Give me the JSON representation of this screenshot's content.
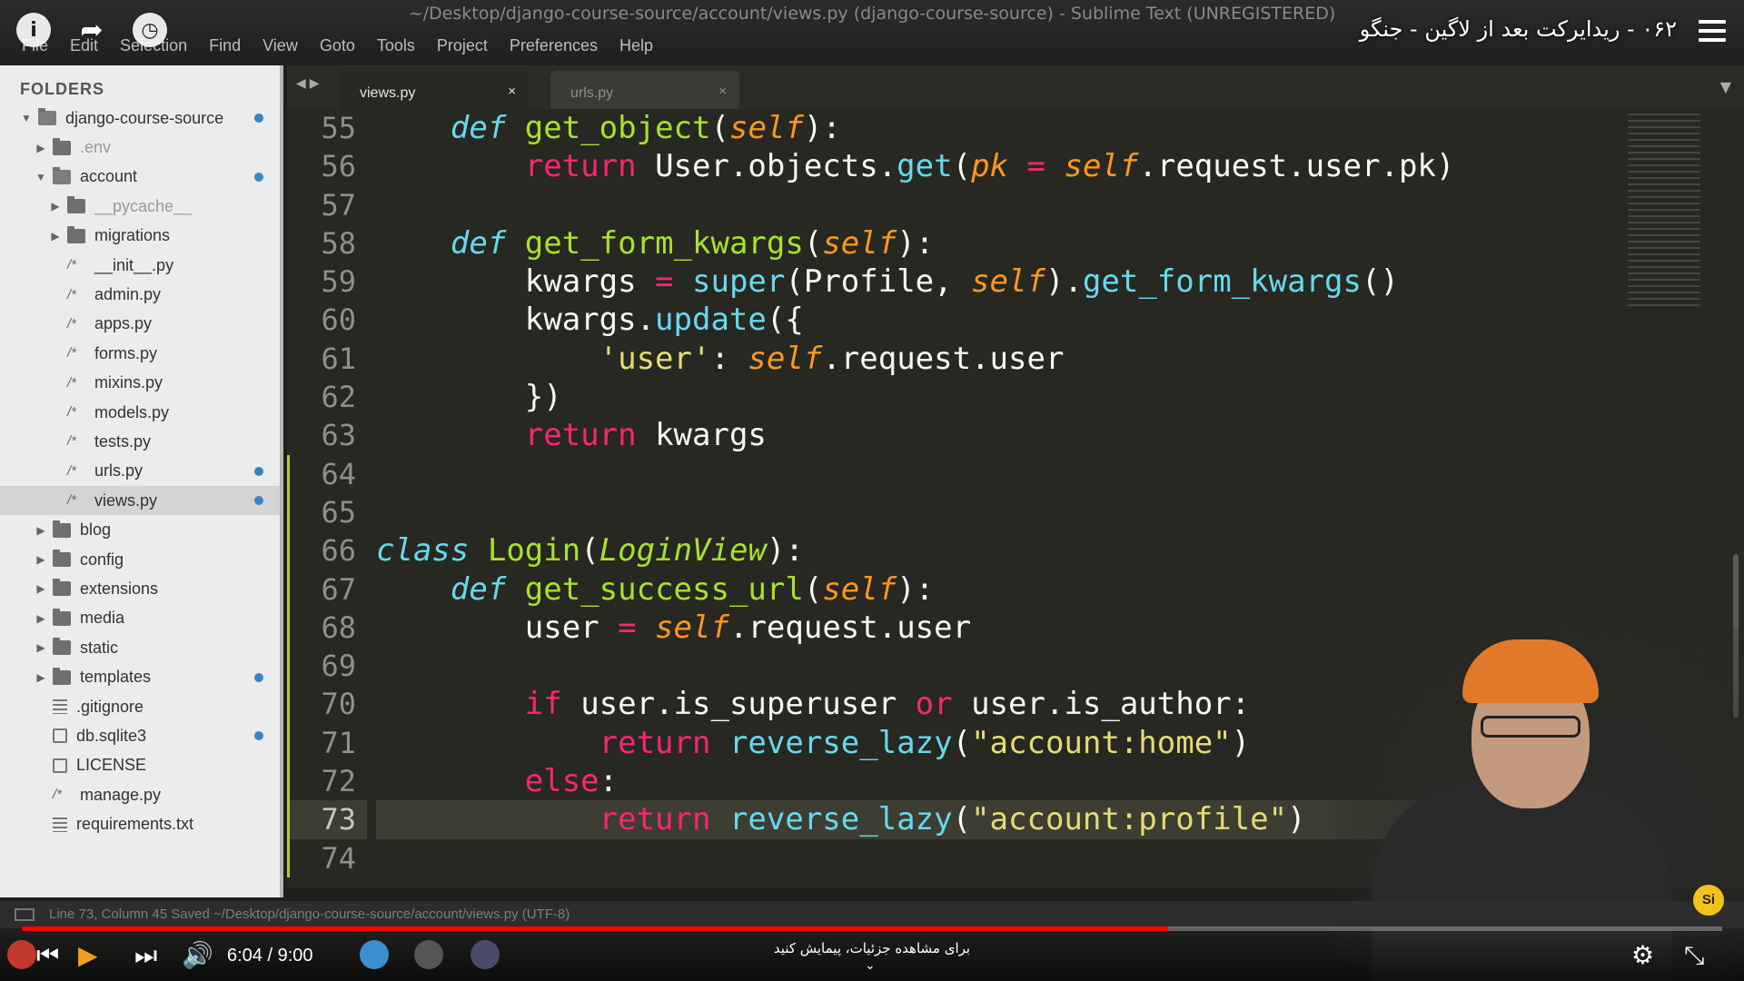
{
  "window": {
    "title": "~/Desktop/django-course-source/account/views.py (django-course-source) - Sublime Text (UNREGISTERED)"
  },
  "menu": [
    "File",
    "Edit",
    "Selection",
    "Find",
    "View",
    "Goto",
    "Tools",
    "Project",
    "Preferences",
    "Help"
  ],
  "youtube": {
    "video_title": "۰۶۲ - ریدایرکت بعد از لاگین - جنگو",
    "time": "6:04 / 9:00",
    "progress_fraction": 0.674,
    "caption_hint": "برای مشاهده جزئیات، پیمایش کنید",
    "badge": "Si"
  },
  "sidebar": {
    "header": "FOLDERS",
    "items": [
      {
        "label": "django-course-source",
        "depth": 0,
        "kind": "folder-open",
        "arrow": "down",
        "dot": true
      },
      {
        "label": ".env",
        "depth": 1,
        "kind": "folder",
        "arrow": "right",
        "dim": true
      },
      {
        "label": "account",
        "depth": 1,
        "kind": "folder-open",
        "arrow": "down",
        "dot": true
      },
      {
        "label": "__pycache__",
        "depth": 2,
        "kind": "folder",
        "arrow": "right",
        "dim": true
      },
      {
        "label": "migrations",
        "depth": 2,
        "kind": "folder",
        "arrow": "right"
      },
      {
        "label": "__init__.py",
        "depth": 2,
        "kind": "file"
      },
      {
        "label": "admin.py",
        "depth": 2,
        "kind": "file"
      },
      {
        "label": "apps.py",
        "depth": 2,
        "kind": "file"
      },
      {
        "label": "forms.py",
        "depth": 2,
        "kind": "file"
      },
      {
        "label": "mixins.py",
        "depth": 2,
        "kind": "file"
      },
      {
        "label": "models.py",
        "depth": 2,
        "kind": "file"
      },
      {
        "label": "tests.py",
        "depth": 2,
        "kind": "file"
      },
      {
        "label": "urls.py",
        "depth": 2,
        "kind": "file",
        "dot": true
      },
      {
        "label": "views.py",
        "depth": 2,
        "kind": "file",
        "dot": true,
        "selected": true
      },
      {
        "label": "blog",
        "depth": 1,
        "kind": "folder",
        "arrow": "right"
      },
      {
        "label": "config",
        "depth": 1,
        "kind": "folder",
        "arrow": "right"
      },
      {
        "label": "extensions",
        "depth": 1,
        "kind": "folder",
        "arrow": "right"
      },
      {
        "label": "media",
        "depth": 1,
        "kind": "folder",
        "arrow": "right"
      },
      {
        "label": "static",
        "depth": 1,
        "kind": "folder",
        "arrow": "right"
      },
      {
        "label": "templates",
        "depth": 1,
        "kind": "folder",
        "arrow": "right",
        "dot": true
      },
      {
        "label": ".gitignore",
        "depth": 1,
        "kind": "lines"
      },
      {
        "label": "db.sqlite3",
        "depth": 1,
        "kind": "doc",
        "dot": true
      },
      {
        "label": "LICENSE",
        "depth": 1,
        "kind": "doc"
      },
      {
        "label": "manage.py",
        "depth": 1,
        "kind": "file"
      },
      {
        "label": "requirements.txt",
        "depth": 1,
        "kind": "lines"
      }
    ]
  },
  "tabs": [
    {
      "label": "views.py",
      "close": "×",
      "active": true
    },
    {
      "label": "urls.py",
      "close": "×",
      "active": false
    }
  ],
  "editor": {
    "current_line": 73,
    "lines": [
      {
        "n": "55",
        "tokens": [
          [
            "    ",
            ""
          ],
          [
            "def",
            "def"
          ],
          [
            " ",
            ""
          ],
          [
            "get_object",
            "fn"
          ],
          [
            "(",
            ""
          ],
          [
            "self",
            "self"
          ],
          [
            "):",
            ""
          ]
        ]
      },
      {
        "n": "56",
        "tokens": [
          [
            "        ",
            ""
          ],
          [
            "return",
            "kw"
          ],
          [
            " User.objects.",
            ""
          ],
          [
            "get",
            "bi"
          ],
          [
            "(",
            ""
          ],
          [
            "pk",
            "self"
          ],
          [
            " ",
            ""
          ],
          [
            "=",
            "op"
          ],
          [
            " ",
            ""
          ],
          [
            "self",
            "self"
          ],
          [
            ".request.user.pk)",
            ""
          ]
        ]
      },
      {
        "n": "57",
        "tokens": []
      },
      {
        "n": "58",
        "tokens": [
          [
            "    ",
            ""
          ],
          [
            "def",
            "def"
          ],
          [
            " ",
            ""
          ],
          [
            "get_form_kwargs",
            "fn"
          ],
          [
            "(",
            ""
          ],
          [
            "self",
            "self"
          ],
          [
            "):",
            ""
          ]
        ]
      },
      {
        "n": "59",
        "tokens": [
          [
            "        kwargs ",
            ""
          ],
          [
            "=",
            "op"
          ],
          [
            " ",
            ""
          ],
          [
            "super",
            "bi"
          ],
          [
            "(Profile, ",
            ""
          ],
          [
            "self",
            "self"
          ],
          [
            ").",
            ""
          ],
          [
            "get_form_kwargs",
            "bi"
          ],
          [
            "()",
            ""
          ]
        ]
      },
      {
        "n": "60",
        "tokens": [
          [
            "        kwargs.",
            ""
          ],
          [
            "update",
            "bi"
          ],
          [
            "({",
            ""
          ]
        ]
      },
      {
        "n": "61",
        "tokens": [
          [
            "            ",
            ""
          ],
          [
            "'user'",
            "str"
          ],
          [
            ": ",
            ""
          ],
          [
            "self",
            "self"
          ],
          [
            ".request.user",
            ""
          ]
        ]
      },
      {
        "n": "62",
        "tokens": [
          [
            "        })",
            ""
          ]
        ]
      },
      {
        "n": "63",
        "tokens": [
          [
            "        ",
            ""
          ],
          [
            "return",
            "kw"
          ],
          [
            " kwargs",
            ""
          ]
        ]
      },
      {
        "n": "64",
        "tokens": []
      },
      {
        "n": "65",
        "tokens": []
      },
      {
        "n": "66",
        "tokens": [
          [
            "class",
            "def"
          ],
          [
            " ",
            ""
          ],
          [
            "Login",
            "fn"
          ],
          [
            "(",
            ""
          ],
          [
            "LoginView",
            "inh"
          ],
          [
            "):",
            ""
          ]
        ]
      },
      {
        "n": "67",
        "tokens": [
          [
            "    ",
            ""
          ],
          [
            "def",
            "def"
          ],
          [
            " ",
            ""
          ],
          [
            "get_success_url",
            "fn"
          ],
          [
            "(",
            ""
          ],
          [
            "self",
            "self"
          ],
          [
            "):",
            ""
          ]
        ]
      },
      {
        "n": "68",
        "tokens": [
          [
            "        user ",
            ""
          ],
          [
            "=",
            "op"
          ],
          [
            " ",
            ""
          ],
          [
            "self",
            "self"
          ],
          [
            ".request.user",
            ""
          ]
        ]
      },
      {
        "n": "69",
        "tokens": []
      },
      {
        "n": "70",
        "tokens": [
          [
            "        ",
            ""
          ],
          [
            "if",
            "kw"
          ],
          [
            " user.is_superuser ",
            ""
          ],
          [
            "or",
            "kw"
          ],
          [
            " user.is_author:",
            ""
          ]
        ]
      },
      {
        "n": "71",
        "tokens": [
          [
            "            ",
            ""
          ],
          [
            "return",
            "kw"
          ],
          [
            " ",
            ""
          ],
          [
            "reverse_lazy",
            "bi"
          ],
          [
            "(",
            ""
          ],
          [
            "\"account:home\"",
            "str"
          ],
          [
            ")",
            ""
          ]
        ]
      },
      {
        "n": "72",
        "tokens": [
          [
            "        ",
            ""
          ],
          [
            "else",
            "kw"
          ],
          [
            ":",
            ""
          ]
        ]
      },
      {
        "n": "73",
        "tokens": [
          [
            "            ",
            ""
          ],
          [
            "return",
            "kw"
          ],
          [
            " ",
            ""
          ],
          [
            "reverse_lazy",
            "bi"
          ],
          [
            "(",
            ""
          ],
          [
            "\"account:profile\"",
            "str"
          ],
          [
            ")",
            ""
          ]
        ]
      },
      {
        "n": "74",
        "tokens": []
      }
    ]
  },
  "statusbar": {
    "text": "Line 73, Column 45   Saved ~/Desktop/django-course-source/account/views.py (UTF-8)"
  },
  "colors": {
    "editor_bg": "#272822",
    "keyword": "#f92672",
    "function": "#a6e22e",
    "self_param": "#fd971f",
    "builtin": "#66d9ef",
    "string": "#e6db74",
    "progress": "#ff0000"
  }
}
